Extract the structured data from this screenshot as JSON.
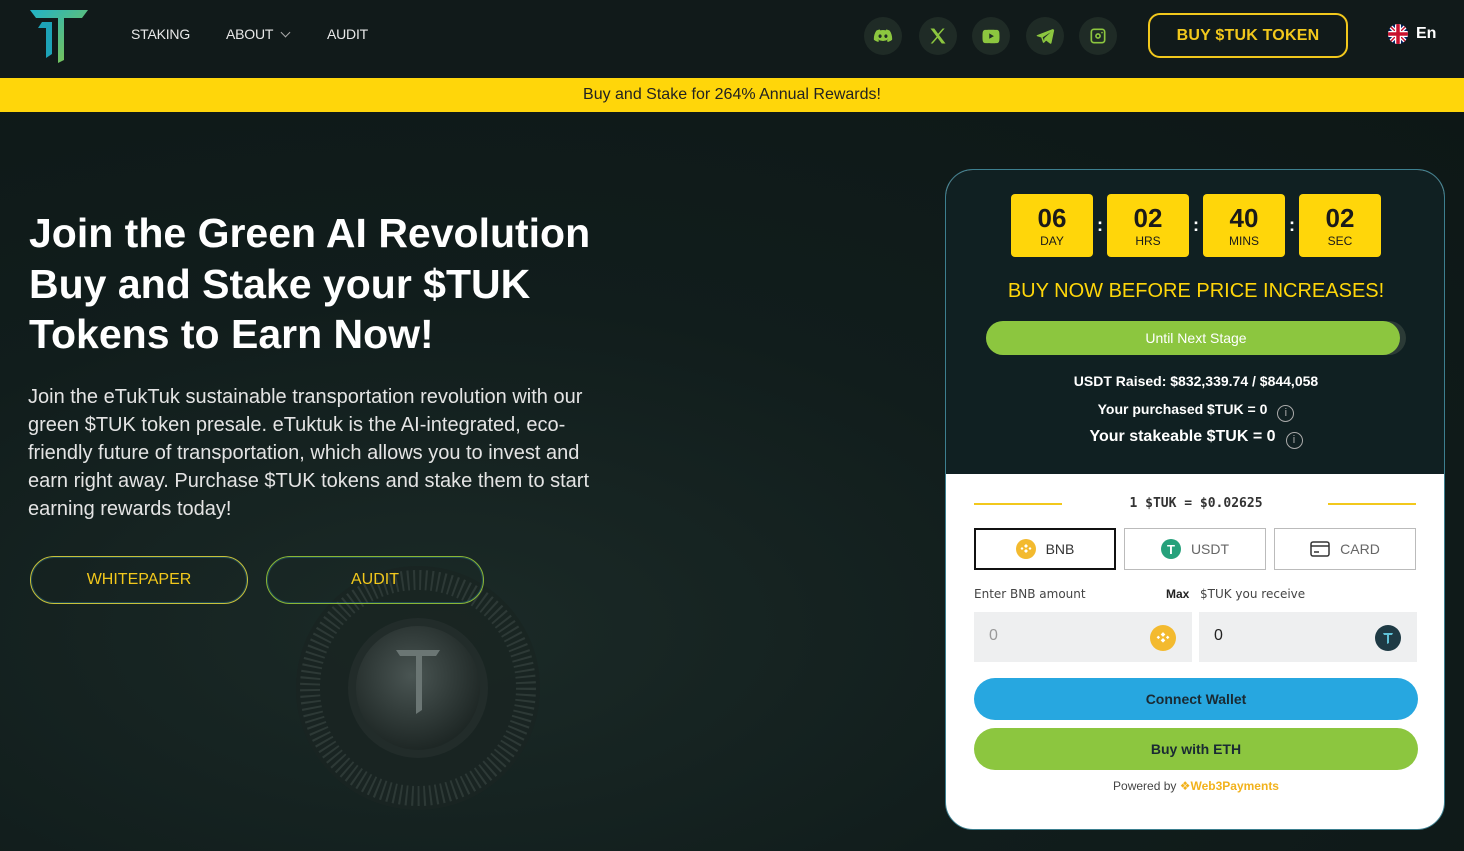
{
  "nav": {
    "links": {
      "staking": "STAKING",
      "about": "ABOUT",
      "audit": "AUDIT"
    },
    "socials": [
      "discord-icon",
      "x-icon",
      "youtube-icon",
      "telegram-icon",
      "instagram-icon"
    ],
    "buy_button": "BUY $TUK TOKEN",
    "language": "En"
  },
  "banner": {
    "text": "Buy and Stake for 264% Annual Rewards!"
  },
  "hero": {
    "title_lines": [
      "Join the Green AI Revolution",
      "Buy and Stake your $TUK",
      "Tokens to Earn Now!"
    ],
    "description": "Join the eTukTuk sustainable transportation revolution with our green $TUK token presale. eTuktuk is the AI-integrated, eco-friendly future of transportation, which allows you to invest and earn right away. Purchase $TUK tokens and stake them to start earning rewards today!",
    "whitepaper_button": "WHITEPAPER",
    "audit_button": "AUDIT"
  },
  "widget": {
    "countdown": [
      {
        "value": "06",
        "label": "DAY"
      },
      {
        "value": "02",
        "label": "HRS"
      },
      {
        "value": "40",
        "label": "MINS"
      },
      {
        "value": "02",
        "label": "SEC"
      }
    ],
    "headline": "BUY NOW BEFORE PRICE INCREASES!",
    "progress": {
      "label": "Until Next Stage",
      "fraction": 0.986
    },
    "raised": "USDT Raised: $832,339.74 / $844,058",
    "purchased": "Your purchased $TUK = 0",
    "stakeable": "Your stakeable $TUK = 0",
    "rate": "1 $TUK = $0.02625",
    "currencies": {
      "bnb": "BNB",
      "usdt": "USDT",
      "card": "CARD"
    },
    "input_label_pay": "Enter BNB amount",
    "max_label": "Max",
    "input_label_receive": "$TUK you receive",
    "pay_value": "0",
    "receive_value": "0",
    "connect_button": "Connect Wallet",
    "eth_button": "Buy with ETH",
    "powered_by": "Powered by",
    "powered_brand": "Web3Payments"
  },
  "colors": {
    "yellow": "#ffd60a",
    "green": "#8cc63f",
    "blue": "#27a7e0",
    "dark": "#102022"
  }
}
